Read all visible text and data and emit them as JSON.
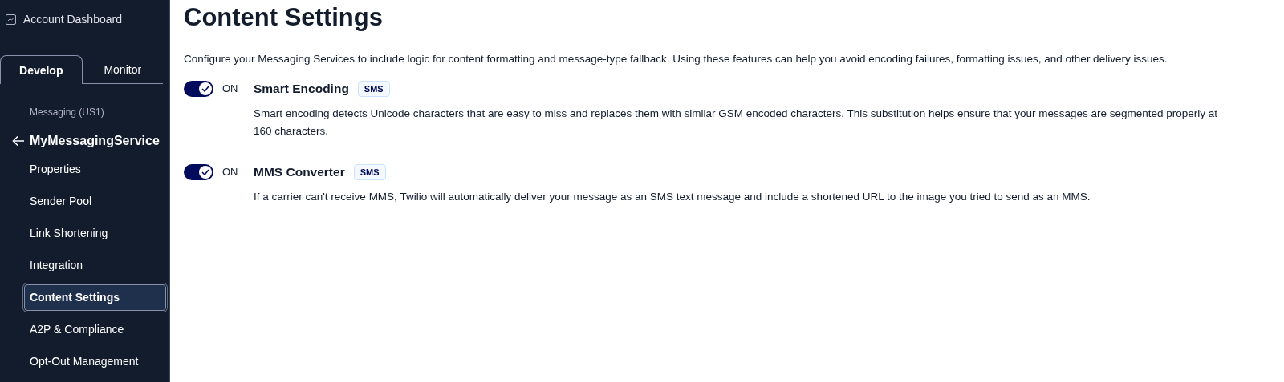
{
  "sidebar": {
    "dashboard_link": "Account Dashboard",
    "tabs": [
      {
        "label": "Develop",
        "selected": true
      },
      {
        "label": "Monitor",
        "selected": false
      }
    ],
    "section": "Messaging (US1)",
    "service": "MyMessagingService",
    "items": [
      {
        "label": "Properties",
        "selected": false
      },
      {
        "label": "Sender Pool",
        "selected": false
      },
      {
        "label": "Link Shortening",
        "selected": false
      },
      {
        "label": "Integration",
        "selected": false
      },
      {
        "label": "Content Settings",
        "selected": true
      },
      {
        "label": "A2P & Compliance",
        "selected": false
      },
      {
        "label": "Opt-Out Management",
        "selected": false
      }
    ]
  },
  "page": {
    "title": "Content Settings",
    "description": "Configure your Messaging Services to include logic for content formatting and message-type fallback. Using these features can help you avoid encoding failures, formatting issues, and other delivery issues.",
    "settings": [
      {
        "on": true,
        "state_label": "ON",
        "name": "Smart Encoding",
        "badge": "SMS",
        "description": "Smart encoding detects Unicode characters that are easy to miss and replaces them with similar GSM encoded characters. This substitution helps ensure that your messages are segmented properly at 160 characters."
      },
      {
        "on": true,
        "state_label": "ON",
        "name": "MMS Converter",
        "badge": "SMS",
        "description": "If a carrier can't receive MMS, Twilio will automatically deliver your message as an SMS text message and include a shortened URL to the image you tried to send as an MMS."
      }
    ]
  }
}
